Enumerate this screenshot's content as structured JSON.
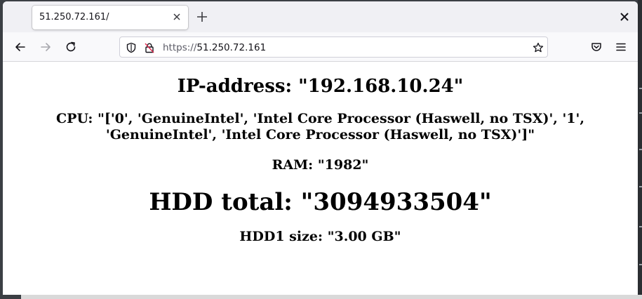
{
  "browser": {
    "tab": {
      "title": "51.250.72.161/",
      "close_icon": "close-icon"
    },
    "new_tab_icon": "plus-icon",
    "window_close_icon": "close-icon",
    "nav": {
      "back_icon": "arrow-left-icon",
      "forward_icon": "arrow-right-icon",
      "reload_icon": "reload-icon",
      "shield_icon": "shield-icon",
      "lock_icon": "lock-icon",
      "url_scheme": "https://",
      "url_host": "51.250.72.161",
      "bookmark_icon": "star-icon",
      "pocket_icon": "pocket-icon",
      "menu_icon": "hamburger-icon"
    }
  },
  "page": {
    "ip_line": "IP-address: \"192.168.10.24\"",
    "cpu_line": "CPU: \"['0', 'GenuineIntel', 'Intel Core Processor (Haswell, no TSX)', '1', 'GenuineIntel', 'Intel Core Processor (Haswell, no TSX)']\"",
    "ram_line": "RAM: \"1982\"",
    "hdd_total_line": "HDD total: \"3094933504\"",
    "hdd1_line": "HDD1 size: \"3.00 GB\""
  },
  "colors": {
    "chrome_bg": "#f0f0f4",
    "navbar_bg": "#f9f9fb",
    "content_bg": "#ffffff",
    "text": "#15141a"
  }
}
